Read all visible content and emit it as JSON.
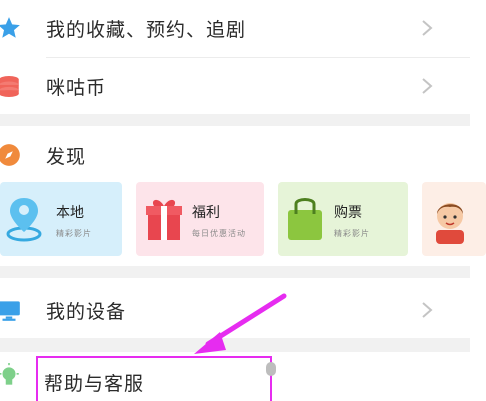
{
  "menu": {
    "favorites_label": "我的收藏、预约、追剧",
    "coins_label": "咪咕币",
    "discover_label": "发现",
    "devices_label": "我的设备",
    "help_label": "帮助与客服"
  },
  "discover_cards": [
    {
      "title": "本地",
      "subtitle": "精彩影片",
      "color": "#d6effb",
      "icon": "location-pin-icon"
    },
    {
      "title": "福利",
      "subtitle": "每日优惠活动",
      "color": "#fde4ea",
      "icon": "gift-box-icon"
    },
    {
      "title": "购票",
      "subtitle": "精彩影片",
      "color": "#e6f4d8",
      "icon": "shopping-bag-icon"
    },
    {
      "title": "",
      "subtitle": "",
      "color": "#fdeee6",
      "icon": "avatar-icon"
    }
  ],
  "colors": {
    "star": "#3aa0e8",
    "coins": "#f0645a",
    "discover": "#f08a3c",
    "device": "#3aa0e8",
    "help": "#7ed08a",
    "annotation": "#e62cf0",
    "chevron": "#c4c4c4"
  }
}
